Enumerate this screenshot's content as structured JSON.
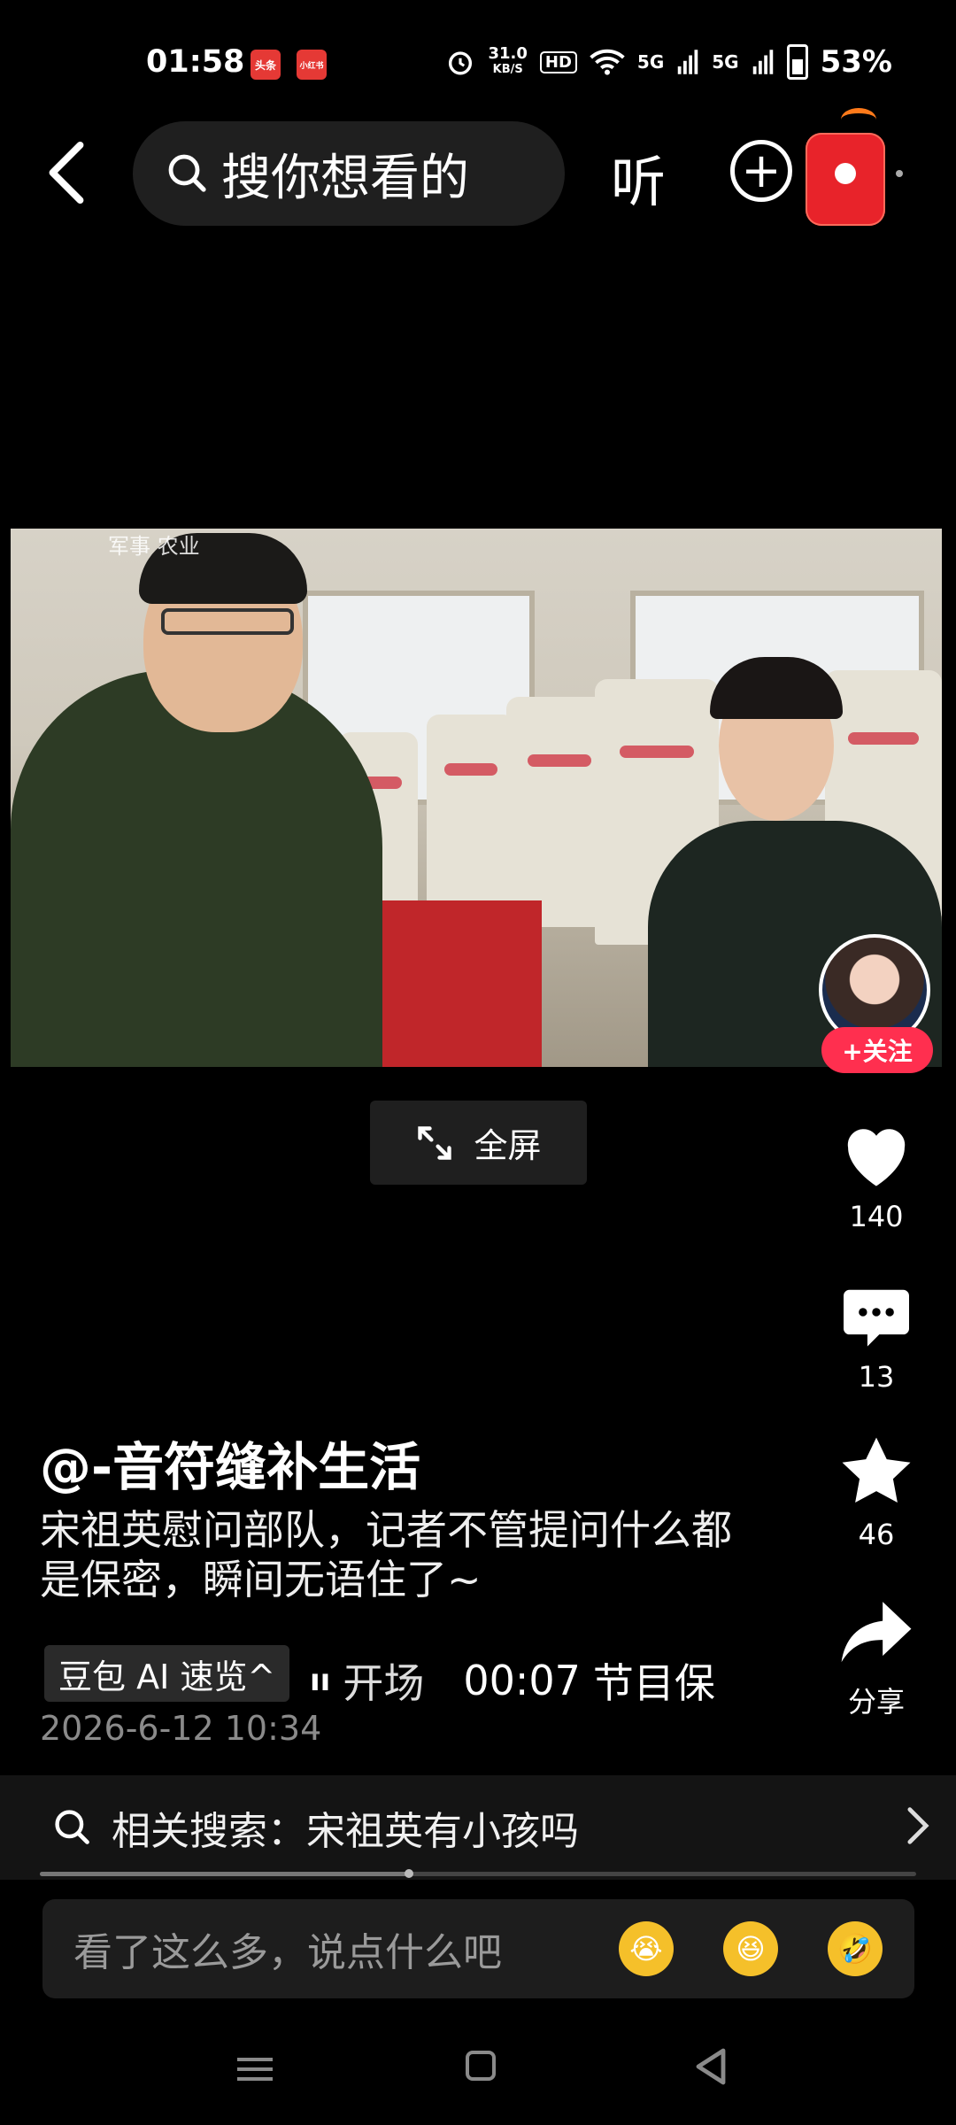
{
  "status_bar": {
    "time": "01:58",
    "app_badge_1": "头条",
    "app_badge_2": "小红书",
    "net_speed_value": "31.0",
    "net_speed_unit": "KB/S",
    "hd": "HD",
    "signal_1": "5G",
    "signal_2": "5G",
    "battery": "53%"
  },
  "top_bar": {
    "search_placeholder": "搜你想看的",
    "listen_label": "听"
  },
  "video": {
    "caption": "军事 农业",
    "follow_label": "+关注",
    "fullscreen_label": "全屏"
  },
  "rail": {
    "likes": "140",
    "comments": "13",
    "favorites": "46",
    "share_label": "分享"
  },
  "post": {
    "author": "@-音符缝补生活",
    "description": "宋祖英慰问部队，记者不管提问什么都是保密，瞬间无语住了~",
    "ai_chip": "豆包 AI 速览^",
    "ai_summary_1": "开场",
    "ai_summary_time": "00:07",
    "ai_summary_2": "节目保",
    "date": "2026-6-12 10:34"
  },
  "related": {
    "label": "相关搜索：宋祖英有小孩吗",
    "progress_fraction": 0.42
  },
  "comment_bar": {
    "placeholder": "看了这么多，说点什么吧",
    "emojis": [
      "crying-emoji",
      "laughing-emoji",
      "rofl-emoji"
    ]
  }
}
